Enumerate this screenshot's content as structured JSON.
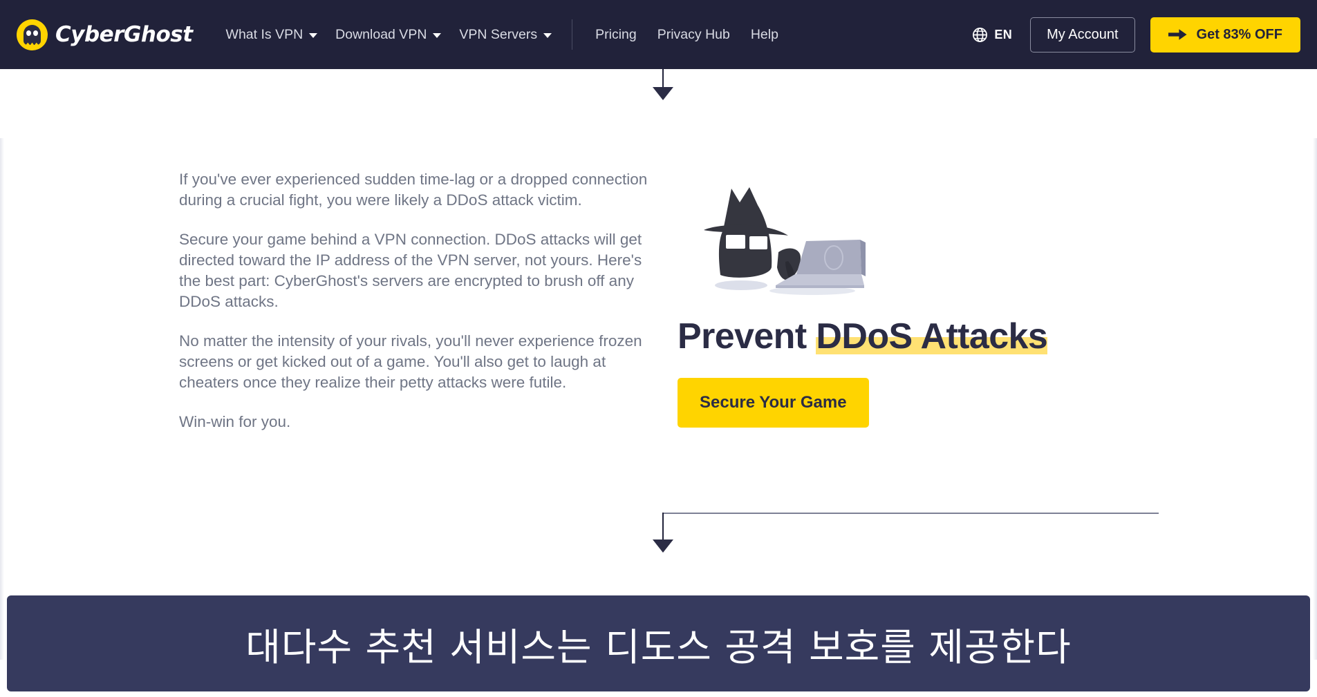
{
  "header": {
    "brand": {
      "name": "CyberGhost",
      "icon": "cyberghost-logo-icon",
      "accent_color": "#ffd400"
    },
    "primary_nav": [
      {
        "label": "What Is VPN",
        "has_dropdown": true,
        "icon": "chevron-down-icon"
      },
      {
        "label": "Download VPN",
        "has_dropdown": true,
        "icon": "chevron-down-icon"
      },
      {
        "label": "VPN Servers",
        "has_dropdown": true,
        "icon": "chevron-down-icon"
      }
    ],
    "secondary_nav": [
      {
        "label": "Pricing"
      },
      {
        "label": "Privacy Hub"
      },
      {
        "label": "Help"
      }
    ],
    "language": {
      "label": "EN",
      "icon": "globe-icon"
    },
    "account_button": {
      "label": "My Account"
    },
    "offer_button": {
      "label": "Get 83% OFF",
      "icon": "arrow-right-icon"
    },
    "background_color": "#21223a"
  },
  "main": {
    "paragraphs": [
      "If you've ever experienced sudden time-lag or a dropped connection during a crucial fight, you were likely a DDoS attack victim.",
      "Secure your game behind a VPN connection. DDoS attacks will get directed toward the IP address of the VPN server, not yours. Here's the best part: CyberGhost's servers are encrypted to brush off any DDoS attacks.",
      "No matter the intensity of your rivals, you'll never experience frozen screens or get kicked out of a game. You'll also get to laugh at cheaters once they realize their petty attacks were futile.",
      "Win-win for you."
    ],
    "illustration": {
      "name": "hacker-cat-laptop-illustration",
      "figure_color": "#35363f",
      "laptop_color": "#a9acc0"
    },
    "headline": {
      "plain": "Prevent ",
      "highlighted": "DDoS Attacks",
      "highlight_color": "#ffe173",
      "text_color": "#2b2c45"
    },
    "cta_button": {
      "label": "Secure Your Game",
      "background_color": "#ffd400"
    }
  },
  "caption": {
    "text": "대다수 추천 서비스는 디도스 공격 보호를 제공한다",
    "background_color": "#363a5e",
    "text_color": "#ffffff"
  }
}
